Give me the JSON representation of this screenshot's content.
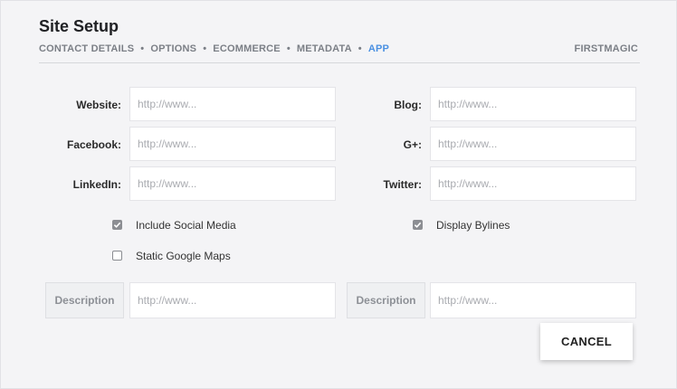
{
  "header": {
    "title": "Site Setup",
    "brand": "FIRSTMAGIC",
    "breadcrumbs": [
      "CONTACT DETAILS",
      "OPTIONS",
      "ECOMMERCE",
      "METADATA",
      "APP"
    ],
    "separator": "•",
    "active_crumb": "APP",
    "accent_color": "#4a90e2"
  },
  "fields": {
    "website": {
      "label": "Website:",
      "placeholder": "http://www..."
    },
    "facebook": {
      "label": "Facebook:",
      "placeholder": "http://www..."
    },
    "linkedin": {
      "label": "LinkedIn:",
      "placeholder": "http://www..."
    },
    "blog": {
      "label": "Blog:",
      "placeholder": "http://www..."
    },
    "gplus": {
      "label": "G+:",
      "placeholder": "http://www..."
    },
    "twitter": {
      "label": "Twitter:",
      "placeholder": "http://www..."
    }
  },
  "checkboxes": {
    "include_social": {
      "label": "Include Social Media",
      "checked": true
    },
    "static_maps": {
      "label": "Static Google Maps",
      "checked": false
    },
    "display_bylines": {
      "label": "Display Bylines",
      "checked": true
    }
  },
  "descriptions": {
    "left": {
      "label": "Description",
      "placeholder": "http://www..."
    },
    "right": {
      "label": "Description",
      "placeholder": "http://www..."
    }
  },
  "actions": {
    "cancel_label": "CANCEL"
  }
}
